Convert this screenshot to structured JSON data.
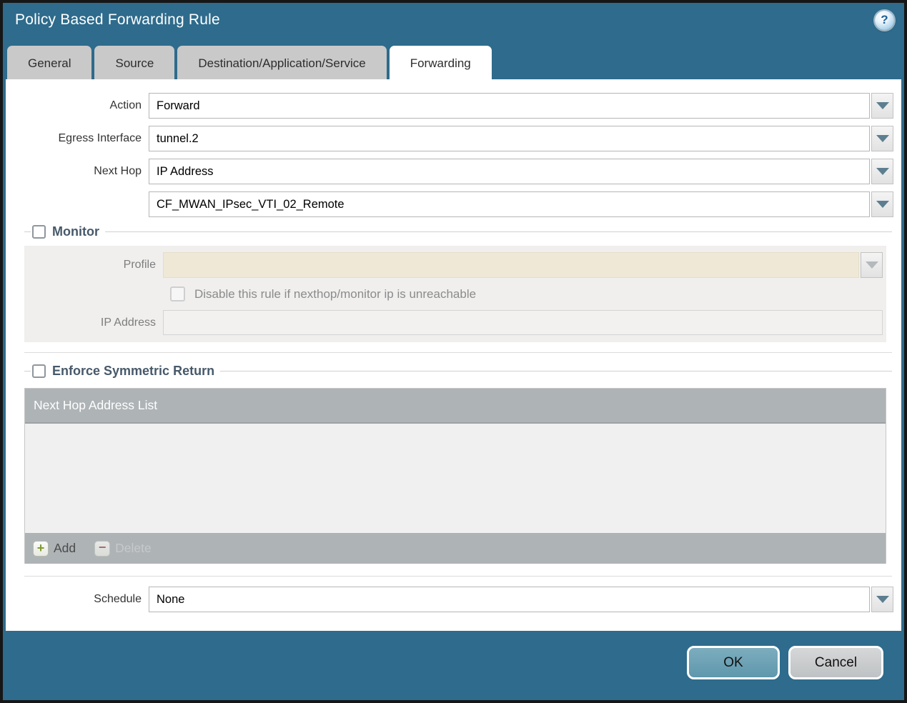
{
  "window": {
    "title": "Policy Based Forwarding Rule",
    "help_glyph": "?"
  },
  "tabs": [
    {
      "label": "General",
      "active": false
    },
    {
      "label": "Source",
      "active": false
    },
    {
      "label": "Destination/Application/Service",
      "active": false
    },
    {
      "label": "Forwarding",
      "active": true
    }
  ],
  "form": {
    "action": {
      "label": "Action",
      "value": "Forward"
    },
    "egress_interface": {
      "label": "Egress Interface",
      "value": "tunnel.2"
    },
    "next_hop": {
      "label": "Next Hop",
      "value": "IP Address"
    },
    "next_hop_address": {
      "value": "CF_MWAN_IPsec_VTI_02_Remote"
    },
    "schedule": {
      "label": "Schedule",
      "value": "None"
    }
  },
  "monitor": {
    "legend": "Monitor",
    "checked": false,
    "profile": {
      "label": "Profile",
      "value": ""
    },
    "disable_rule_checkbox": {
      "label": "Disable this rule if nexthop/monitor ip is unreachable",
      "checked": false
    },
    "ip_address": {
      "label": "IP Address",
      "value": ""
    }
  },
  "symmetric_return": {
    "legend": "Enforce Symmetric Return",
    "checked": false,
    "table_header": "Next Hop Address List",
    "rows": [],
    "add_label": "Add",
    "delete_label": "Delete",
    "add_glyph": "+",
    "delete_glyph": "−"
  },
  "footer": {
    "ok_label": "OK",
    "cancel_label": "Cancel"
  },
  "colors": {
    "window_teal": "#2e6b8c",
    "tab_inactive": "#c9c9c9",
    "table_gray": "#aeb3b6",
    "disabled_cream": "#efe8d6",
    "fieldset_gray": "#f0efee",
    "legend_text": "#47596a",
    "ok_button": "#6ba4b8",
    "cancel_button": "#c9cccd",
    "add_icon_green": "#7e9b2e",
    "delete_icon_red": "#a2574d"
  }
}
